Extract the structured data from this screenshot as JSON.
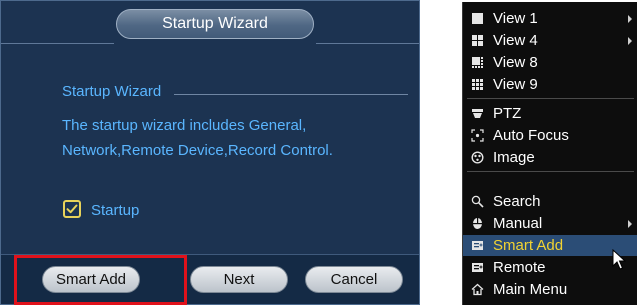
{
  "wizard": {
    "title": "Startup Wizard",
    "section_heading": "Startup Wizard",
    "description": "The startup wizard includes General, Network,Remote Device,Record Control.",
    "startup_checkbox": {
      "label": "Startup",
      "checked": true
    },
    "buttons": {
      "smart_add": "Smart Add",
      "next": "Next",
      "cancel": "Cancel"
    }
  },
  "menu": {
    "items": [
      {
        "label": "View 1",
        "icon": "view-1-icon",
        "submenu": true
      },
      {
        "label": "View 4",
        "icon": "view-4-icon",
        "submenu": true
      },
      {
        "label": "View 8",
        "icon": "view-8-icon",
        "submenu": false
      },
      {
        "label": "View 9",
        "icon": "view-9-icon",
        "submenu": false
      },
      {
        "label": "PTZ",
        "icon": "ptz-icon",
        "submenu": false
      },
      {
        "label": "Auto Focus",
        "icon": "auto-focus-icon",
        "submenu": false
      },
      {
        "label": "Image",
        "icon": "image-icon",
        "submenu": false
      },
      {
        "label": "Search",
        "icon": "search-icon",
        "submenu": false
      },
      {
        "label": "Manual",
        "icon": "manual-icon",
        "submenu": true
      },
      {
        "label": "Smart Add",
        "icon": "smart-add-icon",
        "submenu": false,
        "active": true
      },
      {
        "label": "Remote",
        "icon": "remote-icon",
        "submenu": false
      },
      {
        "label": "Main Menu",
        "icon": "main-menu-icon",
        "submenu": false
      }
    ]
  },
  "colors": {
    "dialog_bg": "#1c3351",
    "text_blue": "#5ab6ff",
    "highlight_red": "#e0121b",
    "menu_active_bg": "#2b4d76",
    "menu_active_text": "#f2d332"
  }
}
